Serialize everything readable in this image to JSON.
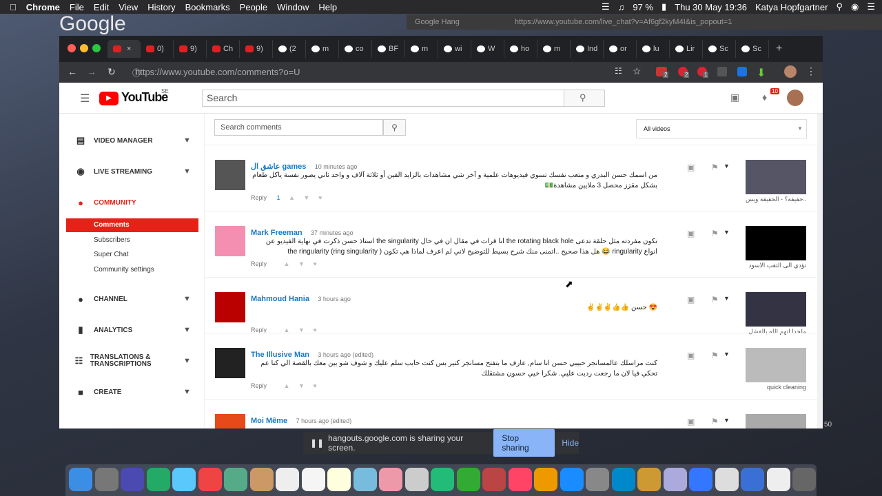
{
  "menubar": {
    "app": "Chrome",
    "items": [
      "File",
      "Edit",
      "View",
      "History",
      "Bookmarks",
      "People",
      "Window",
      "Help"
    ],
    "battery": "97 %",
    "datetime": "Thu 30 May  19:36",
    "user": "Katya Hopfgartner"
  },
  "hangouts_bar": {
    "title": "Google Hang",
    "url": "https://www.youtube.com/live_chat?v=Af6gf2kyM4I&is_popout=1"
  },
  "google_logo": "Google",
  "tabs": [
    "",
    "0)",
    "9)",
    "Ch",
    "9)",
    "(2",
    "m",
    "co",
    "BF",
    "m",
    "wi",
    "W",
    "ho",
    "m",
    "Ind",
    "or",
    "lu",
    "Lir",
    "Sc",
    "Sc"
  ],
  "address": {
    "url": "https://www.youtube.com/comments?o=U",
    "badges": [
      "2",
      "2",
      "1"
    ]
  },
  "youtube": {
    "logo": "YouTube",
    "region": "SE",
    "search_placeholder": "Search",
    "notif_count": "10",
    "sidebar": {
      "sections": [
        {
          "label": "VIDEO MANAGER",
          "icon": "list-icon"
        },
        {
          "label": "LIVE STREAMING",
          "icon": "broadcast-icon"
        },
        {
          "label": "COMMUNITY",
          "icon": "people-icon"
        }
      ],
      "sub": [
        "Comments",
        "Subscribers",
        "Super Chat",
        "Community settings"
      ],
      "sections2": [
        {
          "label": "CHANNEL",
          "icon": "person-icon"
        },
        {
          "label": "ANALYTICS",
          "icon": "bars-icon"
        },
        {
          "label": "TRANSLATIONS & TRANSCRIPTIONS",
          "icon": "translate-icon"
        },
        {
          "label": "CREATE",
          "icon": "camera-icon"
        }
      ]
    },
    "filter": {
      "placeholder": "Search comments",
      "select": "All videos"
    },
    "comments": [
      {
        "name": "عاشق ال games",
        "time": "10 minutes ago",
        "text": "من اسمك حسن البدري و متعب نفسك تسوي فيديوهات علمية و آخر شي مشاهدات بالزايد الفين أو ثلاثة آلاف و واحد ثاني يصور نفسة ياكل طعام بشكل مقزز محصل 3 ملايين مشاهدة💵",
        "reply": "Reply",
        "replies": "1",
        "thumb_title": "حقيقة؟ - الحقيقة ويس..."
      },
      {
        "name": "Mark Freeman",
        "time": "37 minutes ago",
        "text": "تكون مفردته مثل حلقة تدعى the rotating black hole انا قرات في مقال ان في حال the singularity استاذ حسن ذكرت في نهاية الفيديو عن انواع ringularity 😂 هل هذا صحيح ..اتمنى منك شرح بسيط للتوضيح لاني لم اعرف لماذا هي تكون ( the ringularity (ring singularity",
        "reply": "Reply",
        "replies": "",
        "thumb_title": "تؤدي الى الثقب الاسود"
      },
      {
        "name": "Mahmoud Hania",
        "time": "3 hours ago",
        "text": "😍 حسن 👍👍✌✌✌",
        "reply": "Reply",
        "replies": "",
        "thumb_title": "ملحدا اتهم الله بالفشل"
      },
      {
        "name": "The Illusive Man",
        "time": "3 hours ago (edited)",
        "text": "كنت مراسلك عالمسانجر حبيبي حسن انا سام, عارف ما بتفتح مسانجر كتير بس كنت حابب سلم عليك و شوف شو بين معك بالقصة الي كنا عم تحكي فيا لان ما رجعت رديت عليي. شكرا خيي حسون مشتقلك",
        "reply": "Reply",
        "replies": "",
        "thumb_title": "quick cleaning"
      },
      {
        "name": "Moi Même",
        "time": "7 hours ago (edited)",
        "text": "",
        "reply": "",
        "replies": "",
        "thumb_title": ""
      }
    ]
  },
  "sharing": {
    "text": "hangouts.google.com is sharing your screen.",
    "stop": "Stop sharing",
    "hide": "Hide"
  },
  "colors": {
    "yt_red": "#ff0000",
    "link": "#167ac6",
    "stop_btn": "#8ab4f8"
  }
}
